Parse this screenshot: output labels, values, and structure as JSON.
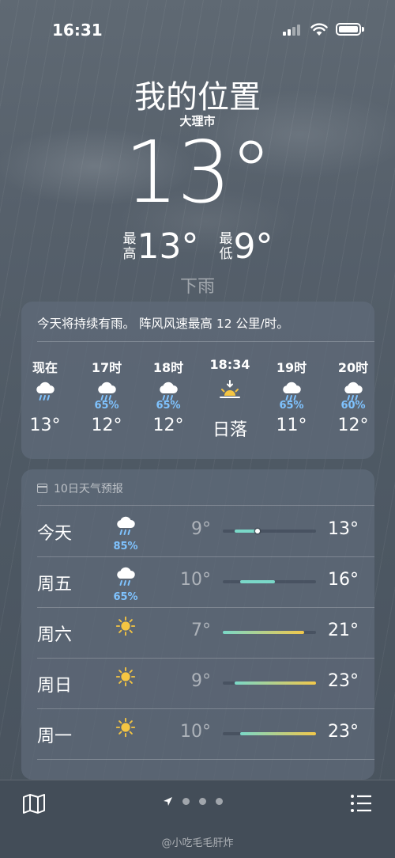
{
  "status": {
    "time": "16:31"
  },
  "header": {
    "location": "我的位置",
    "city": "大理市",
    "temp": "13°",
    "high_label": "最高",
    "high_value": "13°",
    "low_label": "最低",
    "low_value": "9°",
    "condition": "下雨"
  },
  "hourly": {
    "summary": "今天将持续有雨。 阵风风速最高 12 公里/时。",
    "items": [
      {
        "time": "现在",
        "icon": "rain-cloud-icon",
        "pct": "",
        "temp": "13°"
      },
      {
        "time": "17时",
        "icon": "rain-cloud-icon",
        "pct": "65%",
        "temp": "12°"
      },
      {
        "time": "18时",
        "icon": "rain-cloud-icon",
        "pct": "65%",
        "temp": "12°"
      },
      {
        "time": "18:34",
        "icon": "sunset-icon",
        "pct": "",
        "temp": "日落"
      },
      {
        "time": "19时",
        "icon": "rain-cloud-icon",
        "pct": "65%",
        "temp": "11°"
      },
      {
        "time": "20时",
        "icon": "rain-cloud-icon",
        "pct": "60%",
        "temp": "12°"
      }
    ]
  },
  "daily": {
    "title": "10日天气预报",
    "range_min": 7,
    "range_max": 23,
    "colors": {
      "cool": "#7ad8c8",
      "warm": "#f2c84b"
    },
    "rows": [
      {
        "day": "今天",
        "icon": "rain-cloud-icon",
        "pct": "85%",
        "low": "9°",
        "high": "13°",
        "low_n": 9,
        "high_n": 13,
        "current_n": 13
      },
      {
        "day": "周五",
        "icon": "rain-cloud-icon",
        "pct": "65%",
        "low": "10°",
        "high": "16°",
        "low_n": 10,
        "high_n": 16
      },
      {
        "day": "周六",
        "icon": "sun-icon",
        "pct": "",
        "low": "7°",
        "high": "21°",
        "low_n": 7,
        "high_n": 21
      },
      {
        "day": "周日",
        "icon": "sun-icon",
        "pct": "",
        "low": "9°",
        "high": "23°",
        "low_n": 9,
        "high_n": 23
      },
      {
        "day": "周一",
        "icon": "sun-icon",
        "pct": "",
        "low": "10°",
        "high": "23°",
        "low_n": 10,
        "high_n": 23
      }
    ]
  },
  "footer": {
    "watermark": "@小吃毛毛肝炸",
    "page_count": 4,
    "active_page": 0
  }
}
